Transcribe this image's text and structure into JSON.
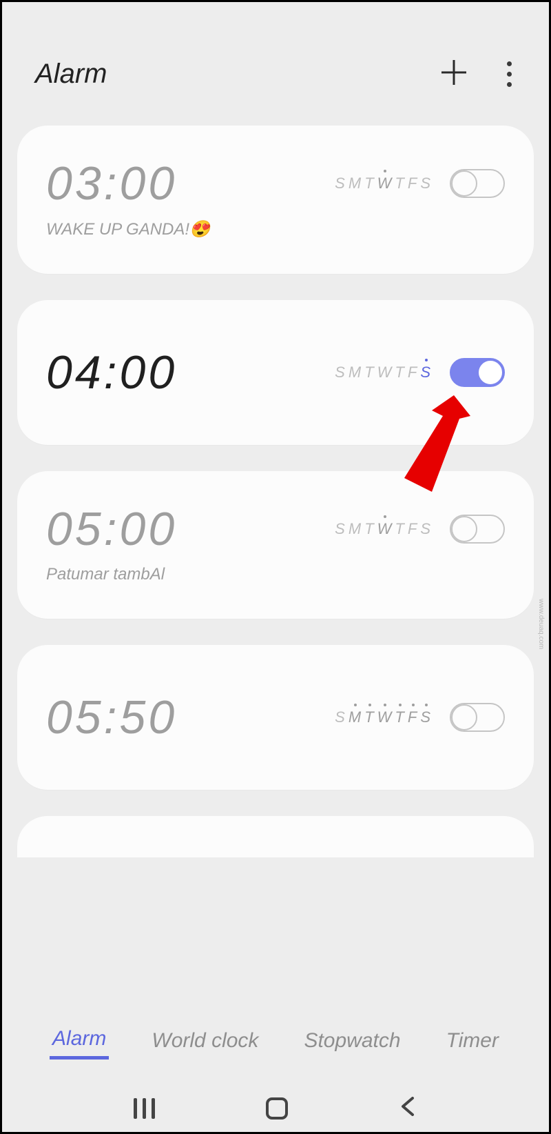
{
  "header": {
    "title": "Alarm"
  },
  "days_letters": [
    "S",
    "M",
    "T",
    "W",
    "T",
    "F",
    "S"
  ],
  "accent": "#5c67de",
  "alarms": [
    {
      "time": "03:00",
      "label": "WAKE UP GANDA!😍",
      "enabled": false,
      "highlight_days": [
        3
      ],
      "dot_days": [
        3
      ]
    },
    {
      "time": "04:00",
      "label": "",
      "enabled": true,
      "highlight_days": [
        6
      ],
      "dot_days": [
        6
      ]
    },
    {
      "time": "05:00",
      "label": "Patumar tambAl",
      "enabled": false,
      "highlight_days": [
        3
      ],
      "dot_days": [
        3
      ]
    },
    {
      "time": "05:50",
      "label": "",
      "enabled": false,
      "highlight_days": [
        1,
        2,
        3,
        4,
        5,
        6
      ],
      "dot_days": [
        1,
        2,
        3,
        4,
        5,
        6
      ]
    }
  ],
  "tabs": {
    "alarm": "Alarm",
    "world_clock": "World clock",
    "stopwatch": "Stopwatch",
    "timer": "Timer",
    "active": "alarm"
  },
  "watermark": "www.deuaq.com"
}
